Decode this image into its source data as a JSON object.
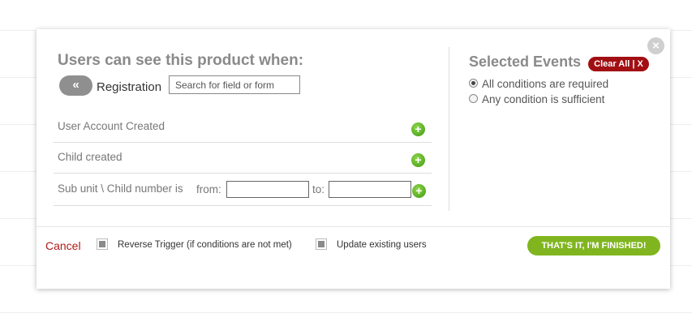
{
  "modal": {
    "close_icon": "×",
    "left_panel": {
      "title": "Users can see this product when:",
      "back_icon": "«",
      "source_label": "Registration",
      "search_placeholder": "Search for field or form",
      "conditions": [
        {
          "label": "User Account Created",
          "add_icon": "+"
        },
        {
          "label": "Child created",
          "add_icon": "+"
        },
        {
          "label": "Sub unit \\ Child number is",
          "from_label": "from:",
          "to_label": "to:",
          "from_value": "",
          "to_value": "",
          "add_icon": "+"
        }
      ]
    },
    "right_panel": {
      "title": "Selected Events",
      "clear_all_label": "Clear All | X",
      "options": [
        {
          "label": "All conditions are required",
          "selected": true
        },
        {
          "label": "Any condition is sufficient",
          "selected": false
        }
      ]
    },
    "footer": {
      "cancel_label": "Cancel",
      "reverse_trigger_label": "Reverse Trigger (if conditions are not met)",
      "update_existing_label": "Update existing users",
      "finish_label": "THAT'S IT, I'M FINISHED!"
    }
  },
  "colors": {
    "accent_green": "#80b51f",
    "danger_red": "#a10f13",
    "cancel_red": "#b11a1a",
    "title_gray": "#8a8a8a"
  }
}
